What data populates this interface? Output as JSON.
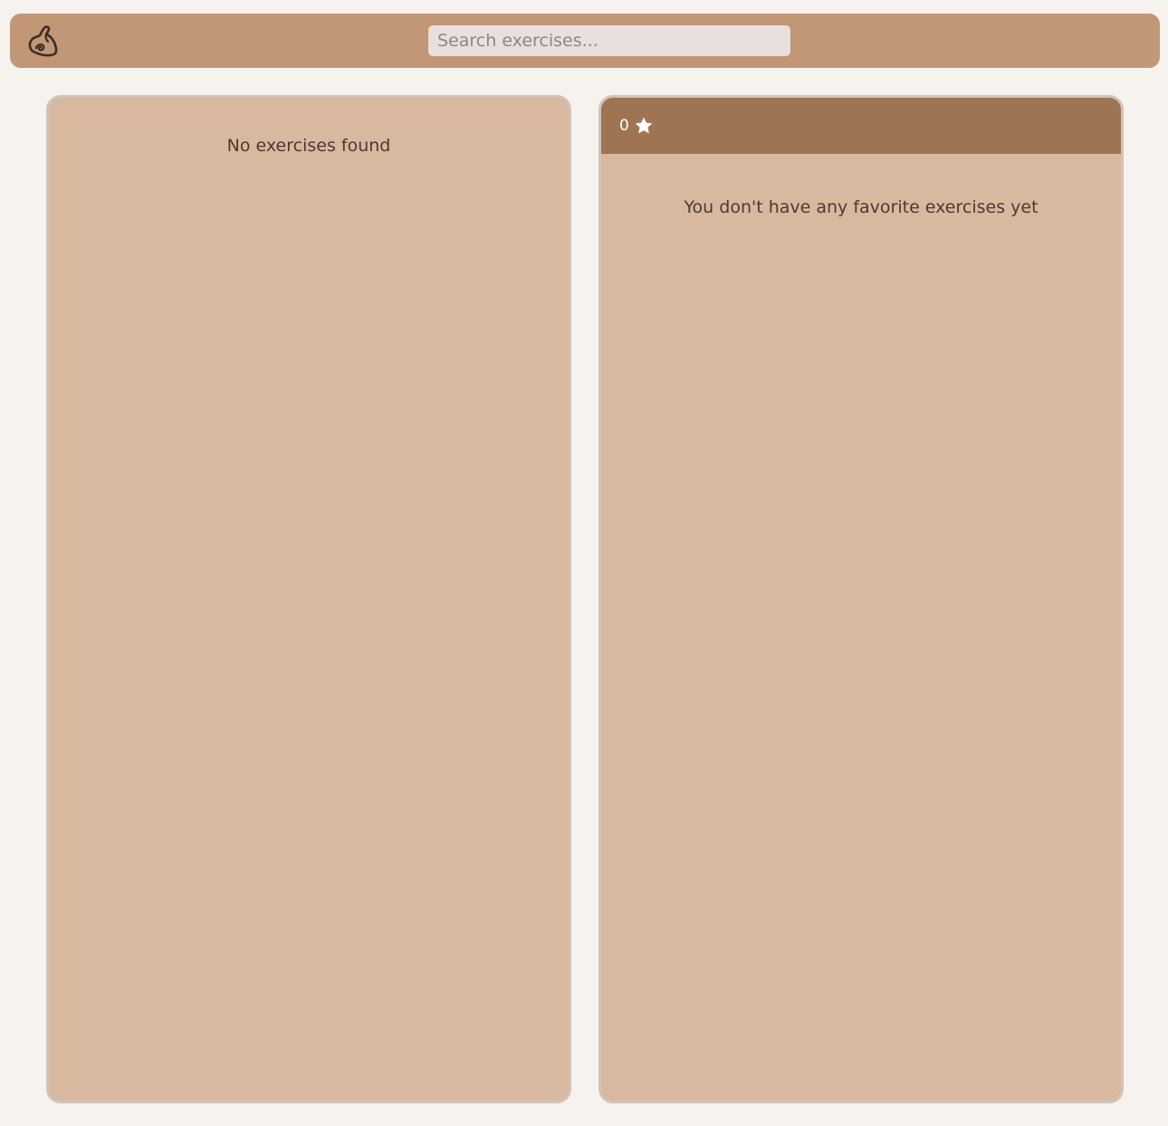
{
  "header": {
    "logo_icon": "flexed-bicep-icon",
    "search": {
      "placeholder": "Search exercises...",
      "value": ""
    }
  },
  "exercise_list": {
    "empty_message": "No exercises found"
  },
  "favorites": {
    "count": "0",
    "count_icon": "star-icon",
    "empty_message": "You don't have any favorite exercises yet"
  },
  "colors": {
    "page_background": "#f6f2ee",
    "header_background": "#c19775",
    "panel_background": "#d9b8a0",
    "favorites_header_background": "#9f7452",
    "text": "#4a3a30"
  }
}
